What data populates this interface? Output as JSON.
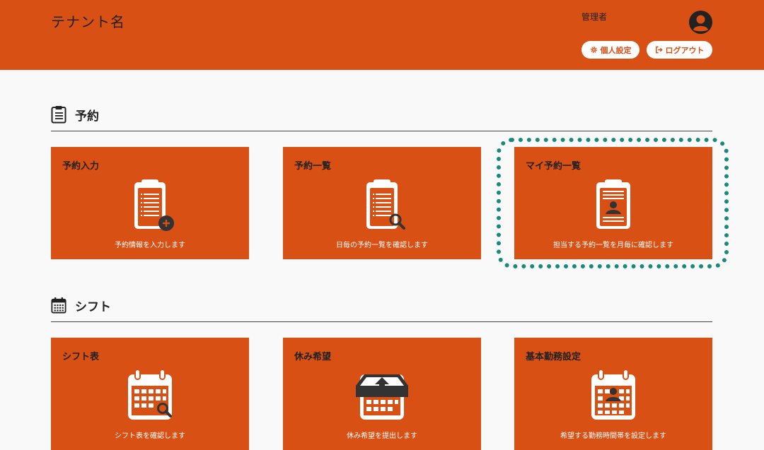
{
  "header": {
    "tenant_name": "テナント名",
    "user_name": "管理者",
    "settings_label": "個人設定",
    "logout_label": "ログアウト"
  },
  "sections": [
    {
      "title": "予約",
      "icon": "clipboard-icon",
      "cards": [
        {
          "title": "予約入力",
          "description": "予約情報を入力します",
          "icon": "clipboard-add-icon"
        },
        {
          "title": "予約一覧",
          "description": "日毎の予約一覧を確認します",
          "icon": "clipboard-search-icon"
        },
        {
          "title": "マイ予約一覧",
          "description": "担当する予約一覧を月毎に確認します",
          "icon": "clipboard-user-icon"
        }
      ]
    },
    {
      "title": "シフト",
      "icon": "calendar-icon",
      "cards": [
        {
          "title": "シフト表",
          "description": "シフト表を確認します",
          "icon": "calendar-search-icon"
        },
        {
          "title": "休み希望",
          "description": "休み希望を提出します",
          "icon": "calendar-upload-icon"
        },
        {
          "title": "基本勤務設定",
          "description": "希望する勤務時間帯を設定します",
          "icon": "calendar-user-icon"
        }
      ]
    }
  ],
  "colors": {
    "brand": "#d85014",
    "highlight": "#1a8a78",
    "background": "#f9f9f9"
  }
}
